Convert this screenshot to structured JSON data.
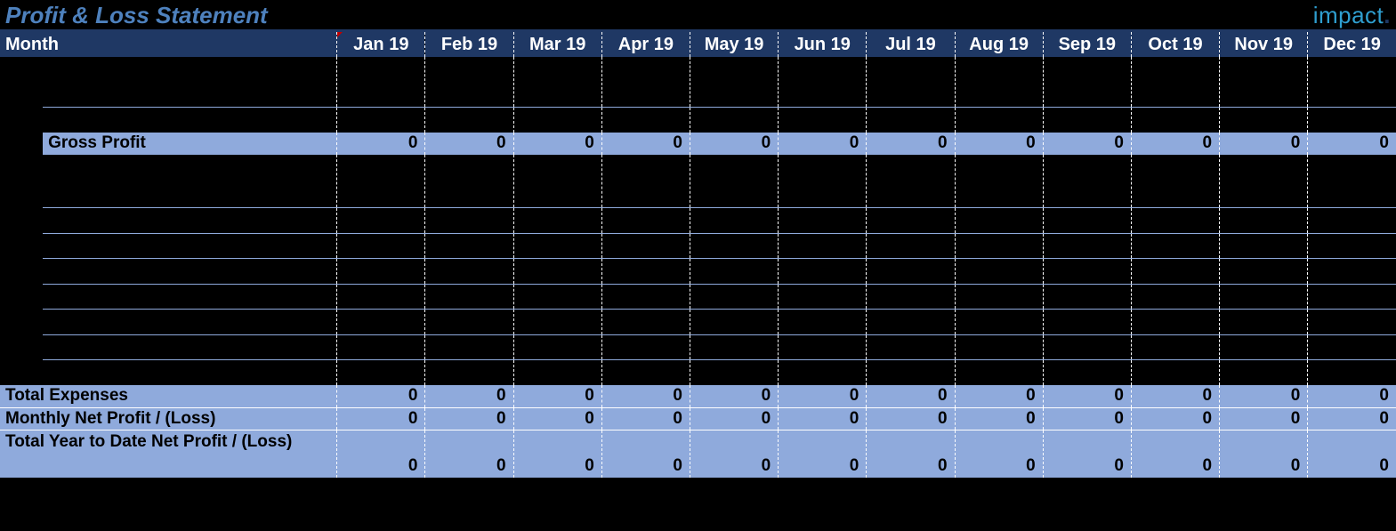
{
  "title": "Profit & Loss Statement",
  "logo": {
    "text": "impact",
    "dot": "."
  },
  "header": {
    "label": "Month",
    "months": [
      "Jan 19",
      "Feb 19",
      "Mar 19",
      "Apr 19",
      "May 19",
      "Jun 19",
      "Jul 19",
      "Aug 19",
      "Sep 19",
      "Oct 19",
      "Nov 19",
      "Dec 19"
    ]
  },
  "rows": {
    "gross_profit": {
      "label": "Gross Profit",
      "values": [
        "0",
        "0",
        "0",
        "0",
        "0",
        "0",
        "0",
        "0",
        "0",
        "0",
        "0",
        "0"
      ]
    },
    "total_expenses": {
      "label": "Total Expenses",
      "values": [
        "0",
        "0",
        "0",
        "0",
        "0",
        "0",
        "0",
        "0",
        "0",
        "0",
        "0",
        "0"
      ]
    },
    "monthly_net": {
      "label": "Monthly Net Profit / (Loss)",
      "values": [
        "0",
        "0",
        "0",
        "0",
        "0",
        "0",
        "0",
        "0",
        "0",
        "0",
        "0",
        "0"
      ]
    },
    "ytd_net": {
      "label": "Total Year to Date Net Profit / (Loss)",
      "values": [
        "0",
        "0",
        "0",
        "0",
        "0",
        "0",
        "0",
        "0",
        "0",
        "0",
        "0",
        "0"
      ]
    }
  }
}
